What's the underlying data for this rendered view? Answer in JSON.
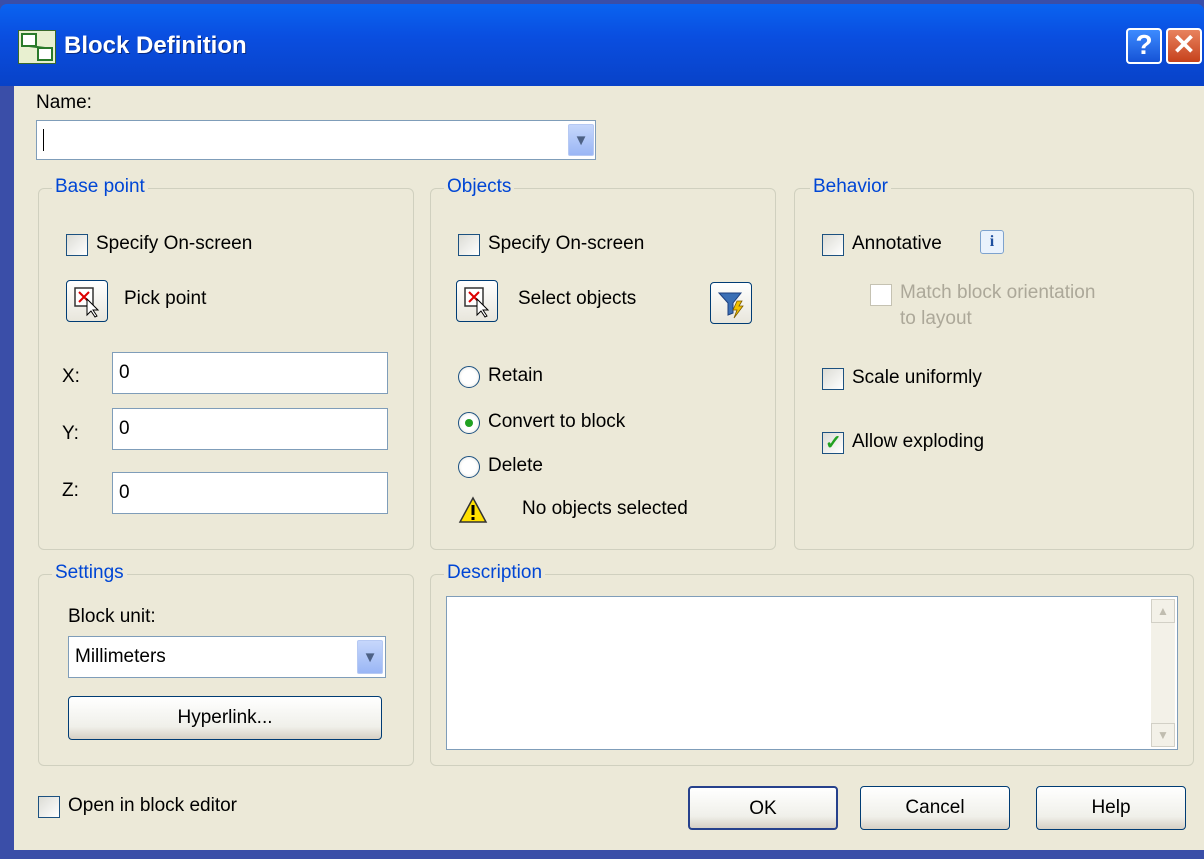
{
  "window": {
    "title": "Block Definition",
    "help_glyph": "?",
    "close_glyph": "✕"
  },
  "name": {
    "label": "Name:",
    "value": ""
  },
  "base_point": {
    "title": "Base point",
    "specify_label": "Specify On-screen",
    "pick_label": "Pick point",
    "x_label": "X:",
    "x_value": "0",
    "y_label": "Y:",
    "y_value": "0",
    "z_label": "Z:",
    "z_value": "0"
  },
  "objects": {
    "title": "Objects",
    "specify_label": "Specify On-screen",
    "select_label": "Select objects",
    "retain_label": "Retain",
    "convert_label": "Convert to block",
    "delete_label": "Delete",
    "status": "No objects selected"
  },
  "behavior": {
    "title": "Behavior",
    "annotative_label": "Annotative",
    "match_line1": "Match block orientation",
    "match_line2": "to layout",
    "scale_label": "Scale uniformly",
    "explode_label": "Allow exploding"
  },
  "settings": {
    "title": "Settings",
    "unit_label": "Block unit:",
    "unit_value": "Millimeters",
    "hyperlink_label": "Hyperlink..."
  },
  "description": {
    "title": "Description",
    "value": ""
  },
  "footer": {
    "open_editor_label": "Open in block editor",
    "ok_label": "OK",
    "cancel_label": "Cancel",
    "help_label": "Help"
  },
  "state": {
    "base_specify": false,
    "objects_specify": false,
    "annotative": false,
    "match_orientation": false,
    "scale_uniformly": false,
    "allow_exploding": true,
    "objects_mode": "convert",
    "open_in_editor": false
  },
  "colors": {
    "titlebar": "#0a4ee0",
    "group_title": "#0046d5",
    "client": "#ece9d8",
    "check": "#21a121"
  }
}
